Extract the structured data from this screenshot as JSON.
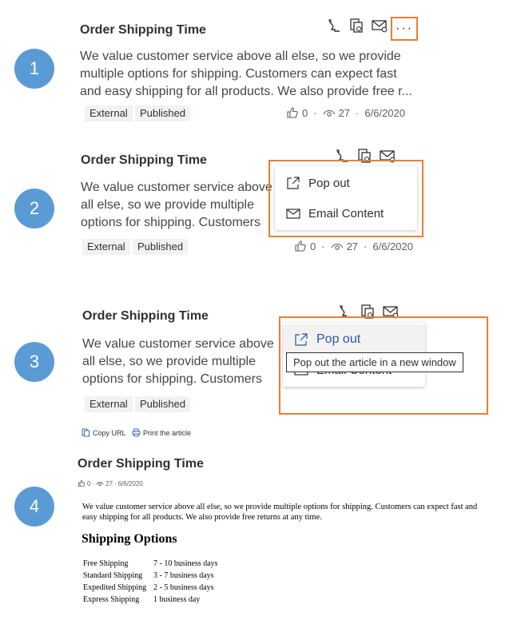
{
  "steps": [
    "1",
    "2",
    "3",
    "4"
  ],
  "article": {
    "title": "Order Shipping Time",
    "snippet": "We value customer service above all else, so we provide multiple options for shipping. Customers can expect fast and easy shipping for all products. We also provide free r...",
    "snippet_truncated": "We value customer service above all else, so we provide multiple options for shipping. Customers can expect fast and easy shipping for all products. We also provide free returns at any time.",
    "tags": [
      "External",
      "Published"
    ],
    "likes": "0",
    "views": "27",
    "date": "6/6/2020",
    "separator": "·"
  },
  "toolbar": {
    "more_label": "···",
    "icons": [
      "link-icon",
      "copy-article-icon",
      "email-icon"
    ]
  },
  "menu": {
    "pop_out_label": "Pop out",
    "email_content_label": "Email Content",
    "tooltip": "Pop out the article in a new window"
  },
  "popout": {
    "copy_url_label": "Copy URL",
    "print_label": "Print the article",
    "title": "Order Shipping Time",
    "body": "We value customer service above all else, so we provide multiple options for shipping. Customers can expect fast and easy shipping for all products. We also provide free returns at any time.",
    "section_heading": "Shipping Options",
    "shipping_rows": [
      {
        "method": "Free Shipping",
        "time": "7 - 10 business days"
      },
      {
        "method": "Standard Shipping",
        "time": "3 - 7 business days"
      },
      {
        "method": "Expedited Shipping",
        "time": "2 - 5 business days"
      },
      {
        "method": "Express Shipping",
        "time": "1 business day"
      }
    ]
  },
  "colors": {
    "step_circle": "#5b9bd5",
    "highlight": "#ed7d31",
    "tag_bg": "#f3f2f1",
    "hover_text": "#2b579a"
  }
}
